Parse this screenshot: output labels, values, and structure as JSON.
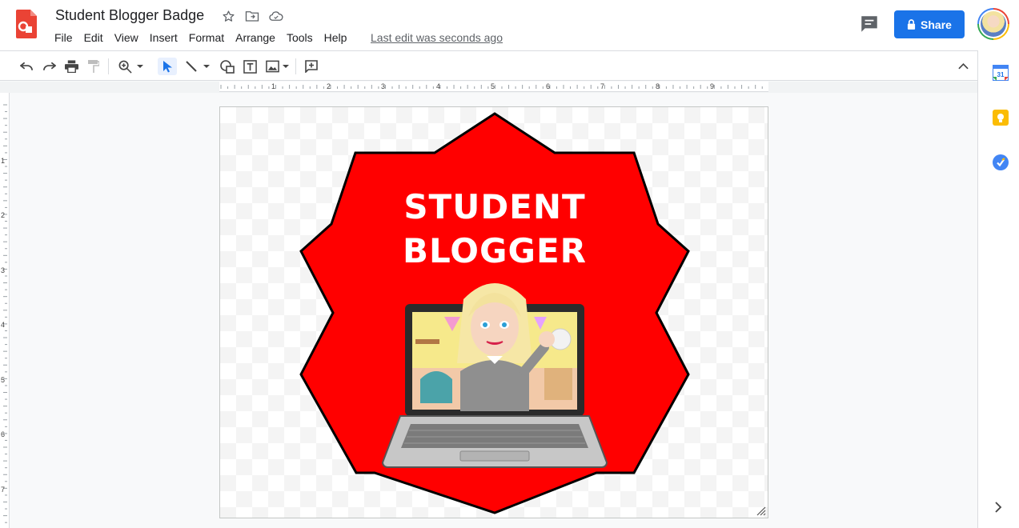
{
  "doc": {
    "title": "Student Blogger Badge",
    "last_edit": "Last edit was seconds ago"
  },
  "menu": [
    "File",
    "Edit",
    "View",
    "Insert",
    "Format",
    "Arrange",
    "Tools",
    "Help"
  ],
  "share": {
    "label": "Share"
  },
  "ruler": {
    "horizontal": [
      "1",
      "2",
      "3",
      "4",
      "5",
      "6",
      "7",
      "8",
      "9"
    ],
    "vertical": [
      "1",
      "2",
      "3",
      "4",
      "5",
      "6",
      "7"
    ]
  },
  "badge": {
    "line1": "STUDENT",
    "line2": "BLOGGER",
    "fill_color": "#ff0000"
  },
  "side_panel": [
    "calendar-icon",
    "keep-icon",
    "tasks-icon"
  ],
  "colors": {
    "share_blue": "#1a73e8",
    "slides_red": "#ea4335"
  }
}
